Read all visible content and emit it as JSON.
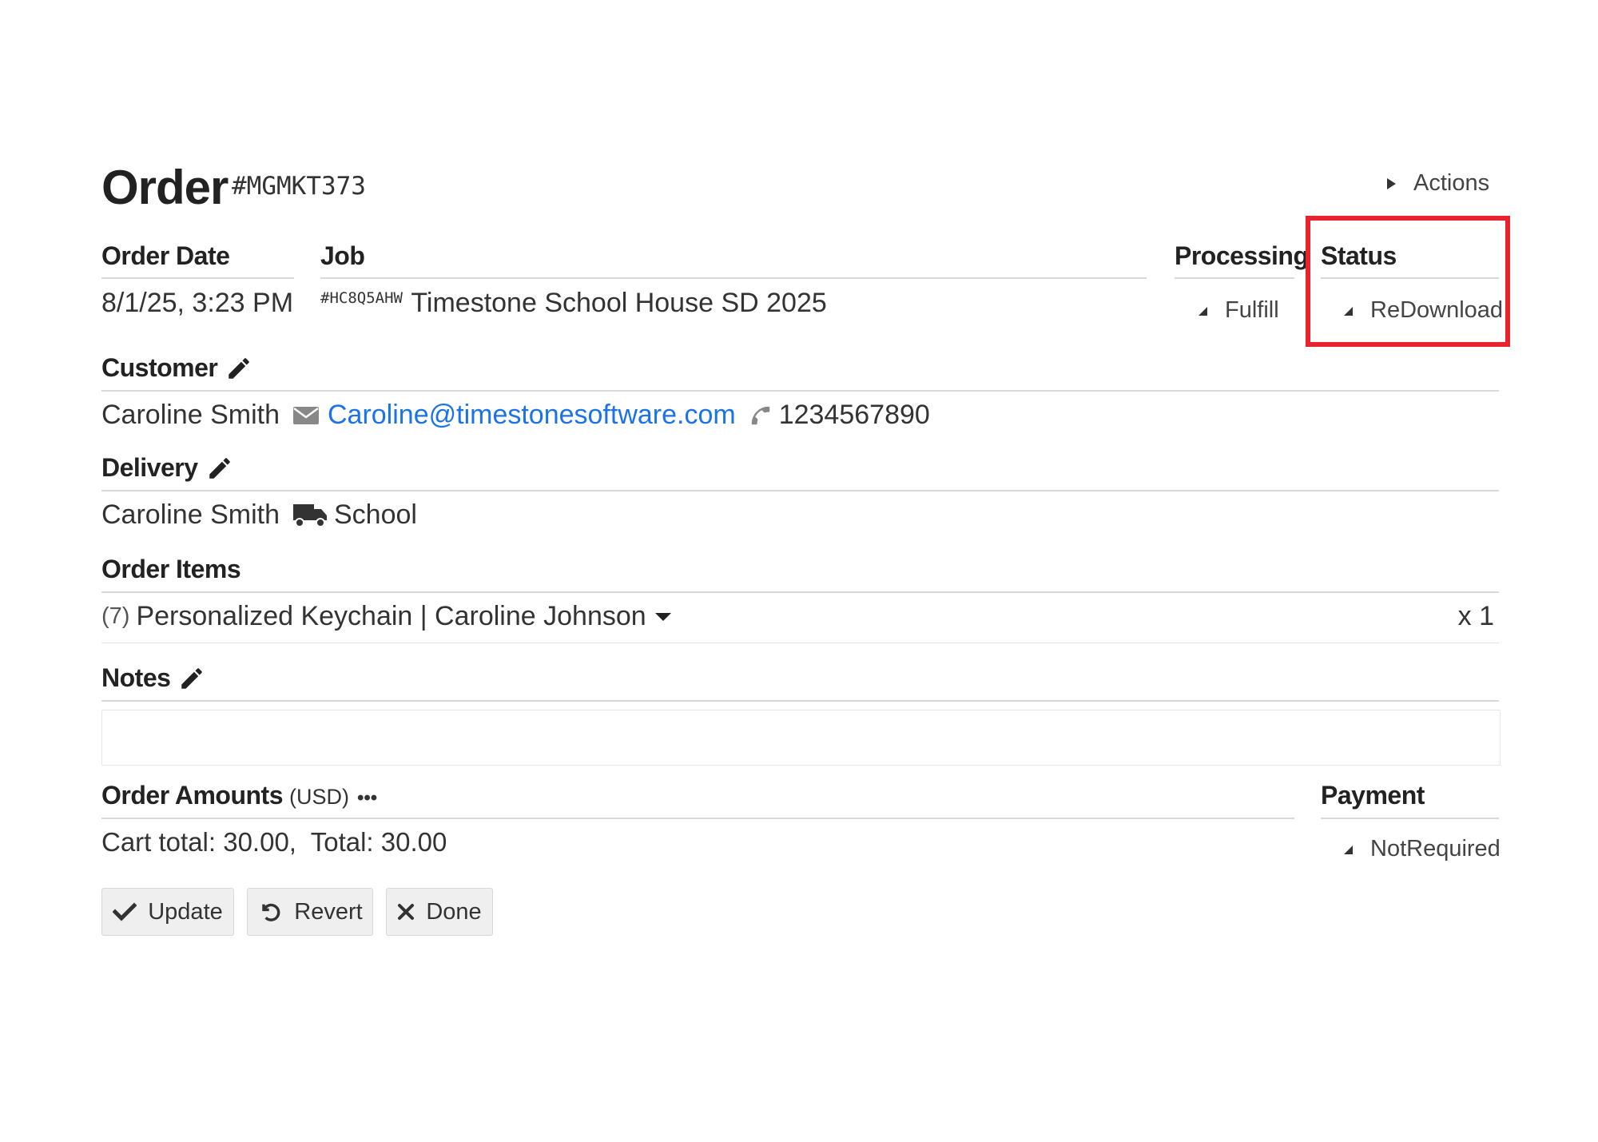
{
  "header": {
    "title": "Order",
    "order_number": "#MGMKT373",
    "actions_label": "Actions"
  },
  "columns": {
    "order_date_label": "Order Date",
    "job_label": "Job",
    "processing_label": "Processing",
    "status_label": "Status"
  },
  "values": {
    "order_date": "8/1/25, 3:23 PM",
    "job_code": "#HC8Q5AHW",
    "job_name": "Timestone School House SD 2025",
    "processing": "Fulfill",
    "status": "ReDownload"
  },
  "customer": {
    "label": "Customer",
    "name": "Caroline Smith",
    "email": "Caroline@timestonesoftware.com",
    "phone": "1234567890"
  },
  "delivery": {
    "label": "Delivery",
    "name": "Caroline Smith",
    "method": "School"
  },
  "order_items": {
    "label": "Order Items",
    "items": [
      {
        "id": "(7)",
        "description": "Personalized Keychain | Caroline Johnson",
        "quantity": "x 1"
      }
    ]
  },
  "notes": {
    "label": "Notes",
    "value": ""
  },
  "amounts": {
    "label": "Order Amounts",
    "currency": "(USD)",
    "more": "•••",
    "summary": "Cart total: 30.00,  Total: 30.00"
  },
  "payment": {
    "label": "Payment",
    "value": "NotRequired"
  },
  "buttons": {
    "update": "Update",
    "revert": "Revert",
    "done": "Done"
  },
  "colors": {
    "link": "#1a73e8",
    "highlight": "#e8232d"
  }
}
